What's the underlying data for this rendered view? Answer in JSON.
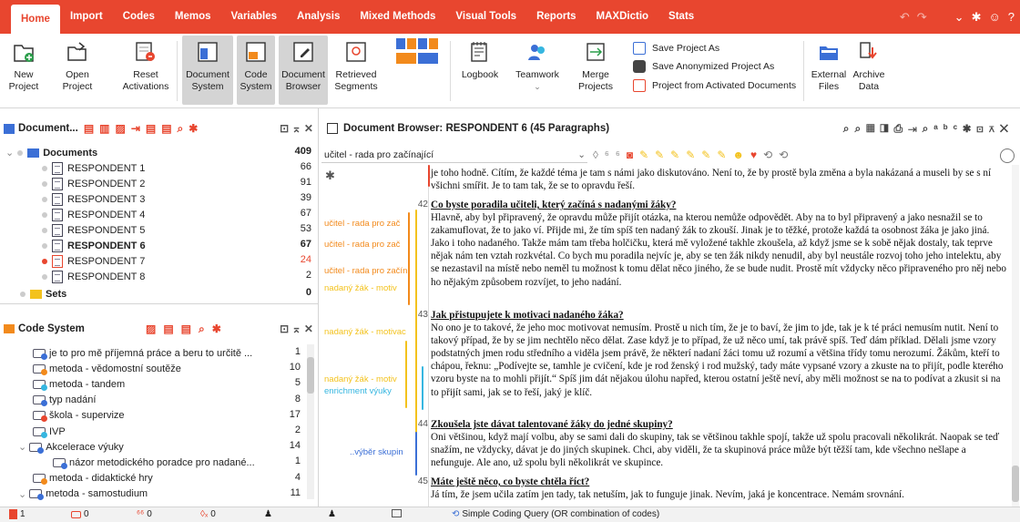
{
  "tabs": [
    "Home",
    "Import",
    "Codes",
    "Memos",
    "Variables",
    "Analysis",
    "Mixed Methods",
    "Visual Tools",
    "Reports",
    "MAXDictio",
    "Stats"
  ],
  "ribbon": {
    "new": "New\nProject",
    "open": "Open\nProject",
    "reset": "Reset\nActivations",
    "docsys": "Document\nSystem",
    "codesys": "Code\nSystem",
    "docbrowser": "Document\nBrowser",
    "retrieved": "Retrieved\nSegments",
    "logbook": "Logbook",
    "teamwork": "Teamwork",
    "merge": "Merge\nProjects",
    "save_as": "Save Project As",
    "save_anon": "Save Anonymized Project As",
    "from_activated": "Project from Activated Documents",
    "external": "External\nFiles",
    "archive": "Archive\nData"
  },
  "docpanel": {
    "title": "Document...",
    "root": "Documents",
    "root_count": "409",
    "sets": "Sets",
    "sets_count": "0",
    "items": [
      {
        "name": "RESPONDENT 1",
        "count": "66"
      },
      {
        "name": "RESPONDENT 2",
        "count": "91"
      },
      {
        "name": "RESPONDENT 3",
        "count": "39"
      },
      {
        "name": "RESPONDENT 4",
        "count": "67"
      },
      {
        "name": "RESPONDENT 5",
        "count": "53"
      },
      {
        "name": "RESPONDENT 6",
        "count": "67"
      },
      {
        "name": "RESPONDENT 7",
        "count": "24"
      },
      {
        "name": "RESPONDENT 8",
        "count": "2"
      }
    ]
  },
  "codepanel": {
    "title": "Code System",
    "items": [
      {
        "name": "je to pro mě příjemná práce a beru to určitě ...",
        "count": "1"
      },
      {
        "name": "metoda - vědomostní soutěže",
        "count": "10"
      },
      {
        "name": "metoda - tandem",
        "count": "5"
      },
      {
        "name": "typ nadání",
        "count": "8"
      },
      {
        "name": "škola - supervize",
        "count": "17"
      },
      {
        "name": "IVP",
        "count": "2"
      },
      {
        "name": "Akcelerace výuky",
        "count": "14"
      },
      {
        "name": "názor metodického poradce pro nadané...",
        "count": "1"
      },
      {
        "name": "metoda - didaktické hry",
        "count": "4"
      },
      {
        "name": "metoda - samostudium",
        "count": "11"
      }
    ]
  },
  "browser": {
    "title": "Document Browser: RESPONDENT 6  (45 Paragraphs)",
    "code_select": "učitel - rada pro začínající",
    "code_labels": [
      "učitel - rada pro zač",
      "učitel - rada pro zač",
      "učitel - rada pro začín",
      "nadaný žák - motiv",
      "nadaný žák - motivac",
      "nadaný žák - motiv",
      "enrichment výuky",
      "..výběr skupin"
    ]
  },
  "paragraphs": [
    {
      "num": "",
      "question": "",
      "text": "je toho hodně. Cítím, že každé téma je tam s námi jako diskutováno. Není to, že by prostě byla změna a byla nakázaná a museli by se s ní všichni smířit. Je to tam tak, že se to opravdu řeší."
    },
    {
      "num": "42",
      "question": "Co byste poradila učiteli, který začíná s nadanými žáky?",
      "text": "Hlavně, aby byl připravený, že opravdu může přijít otázka, na kterou nemůže odpovědět. Aby na to byl připravený a jako nesnažil se to zakamuflovat, že to jako ví. Přijde mi, že tím spíš ten nadaný žák to zkouší. Jinak je to těžké, protože každá ta osobnost žáka je jako jiná. Jako i toho nadaného. Takže mám tam třeba holčičku, která mě vyložené takhle zkoušela, až když jsme se k sobě nějak dostaly, tak teprve nějak nám ten vztah rozkvétal. Co bych mu poradila nejvíc je, aby se ten žák nikdy nenudil, aby byl neustále rozvoj toho jeho intelektu, aby se nezastavil na místě nebo neměl tu možnost k tomu dělat něco jiného, že se bude nudit. Prostě mít vždycky něco připraveného pro něj nebo ho nějakým způsobem rozvíjet, to jeho nadání."
    },
    {
      "num": "43",
      "question": "Jak přistupujete k motivaci nadaného žáka?",
      "text": "No ono je to takové, že jeho moc motivovat nemusím. Prostě u nich tím, že je to baví, že jim to jde, tak je k té práci nemusím nutit. Není to takový případ, že by se jim nechtělo něco dělat. Zase když je to případ, že už něco umí, tak právě spíš. Teď dám příklad. Dělali jsme vzory podstatných jmen rodu středního a viděla jsem právě, že některí nadaní žáci tomu už rozumí a většina třídy tomu nerozumí. Žákům, kteří to chápou, řeknu: „Podívejte se, tamhle je cvičení, kde je rod ženský i rod mužský, tady máte vypsané vzory a zkuste na to přijít, podle kterého vzoru byste na to mohli přijít.“ Spíš jim dát nějakou úlohu napřed, kterou ostatní ještě neví, aby měli možnost se na to podívat a zkusit si na to přijít sami, jak se to řeší, jaký je klíč."
    },
    {
      "num": "44",
      "question": "Zkoušela jste dávat talentované žáky do jedné skupiny?",
      "text": "Oni většinou, když mají volbu, aby se sami dali do skupiny, tak se většinou takhle spojí, takže už spolu pracovali několikrát. Naopak se teď snažím, ne vždycky, dávat je do jiných skupinek. Chci, aby viděli, že ta skupinová práce může být těžší tam, kde všechno nešlape a nefunguje. Ale ano, už spolu byli několikrát ve skupince."
    },
    {
      "num": "45",
      "question": "Máte ještě něco, co byste chtěla říct?",
      "text": "Já tím, že jsem učila zatím jen tady, tak netuším, jak to funguje jinak. Nevím, jaká je koncentrace. Nemám srovnání."
    }
  ],
  "status": {
    "s1": "1",
    "s2": "0",
    "s3": "0",
    "s4": "0",
    "query": "Simple Coding Query (OR combination of codes)"
  },
  "colors": {
    "brand": "#e8462f",
    "orange": "#f28a1c",
    "yellow": "#f3c21d",
    "cyan": "#36b6e0",
    "blue": "#3b6fd6"
  }
}
